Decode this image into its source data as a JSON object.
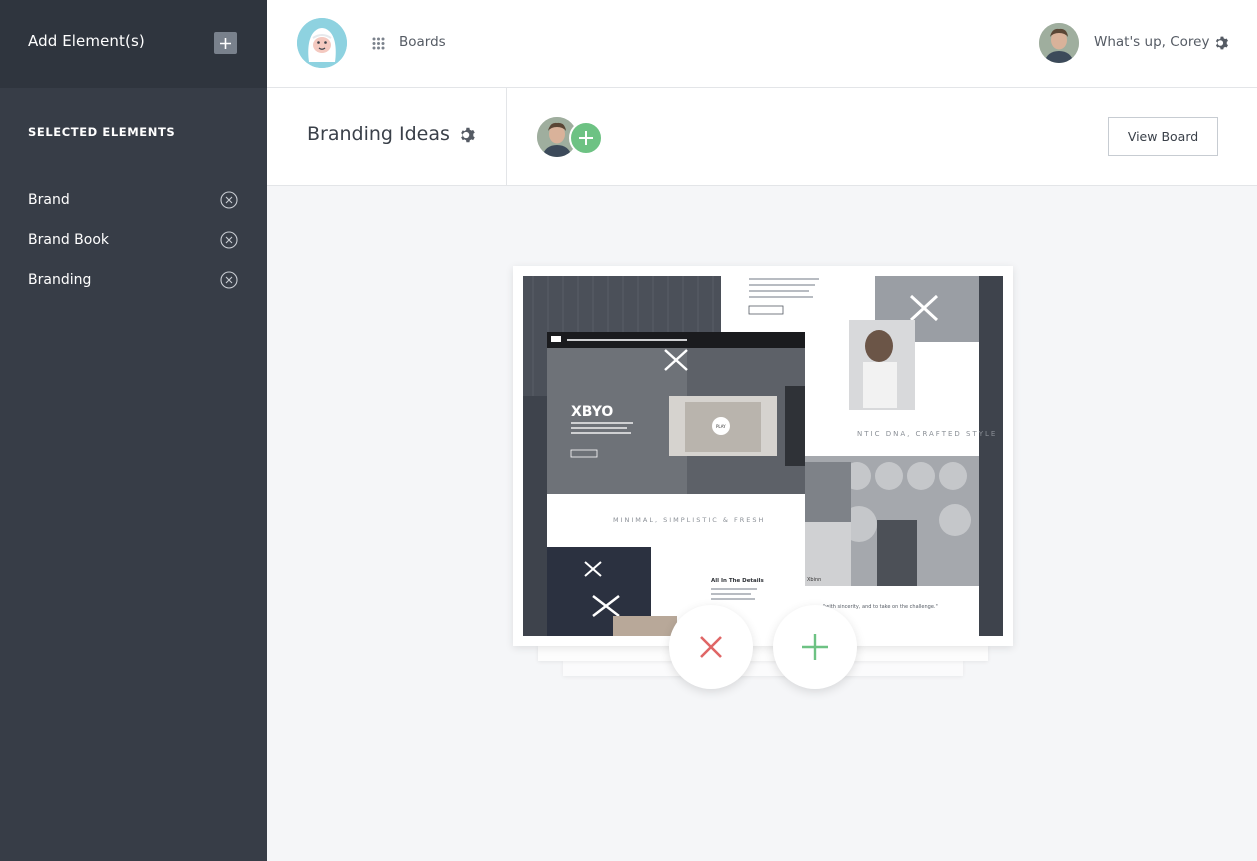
{
  "sidebar": {
    "add_title": "Add Element(s)",
    "selected_heading": "SELECTED ELEMENTS",
    "items": [
      {
        "label": "Brand"
      },
      {
        "label": "Brand Book"
      },
      {
        "label": "Branding"
      }
    ]
  },
  "topbar": {
    "boards_label": "Boards",
    "greeting": "What's up, Corey"
  },
  "board": {
    "title": "Branding Ideas",
    "view_button": "View Board"
  },
  "card": {
    "hero_brand": "XBYO",
    "tagline_1": "MINIMAL, SIMPLISTIC & FRESH",
    "tagline_2": "NTIC DNA, CRAFTED STYLE",
    "section_title": "All In The Details",
    "quote": "\"with sincerity, and to take on the challenge.\"",
    "play_label": "PLAY"
  },
  "colors": {
    "sidebar_bg": "#373d47",
    "sidebar_top_bg": "#2f353e",
    "accent_green": "#6dc283",
    "reject_red": "#e06666",
    "logo_bg": "#8ed2e0"
  },
  "icons": {
    "add": "plus-icon",
    "remove": "circle-x-icon",
    "grid": "grid-icon",
    "settings": "gear-icon",
    "reject": "x-icon",
    "approve": "plus-icon"
  }
}
